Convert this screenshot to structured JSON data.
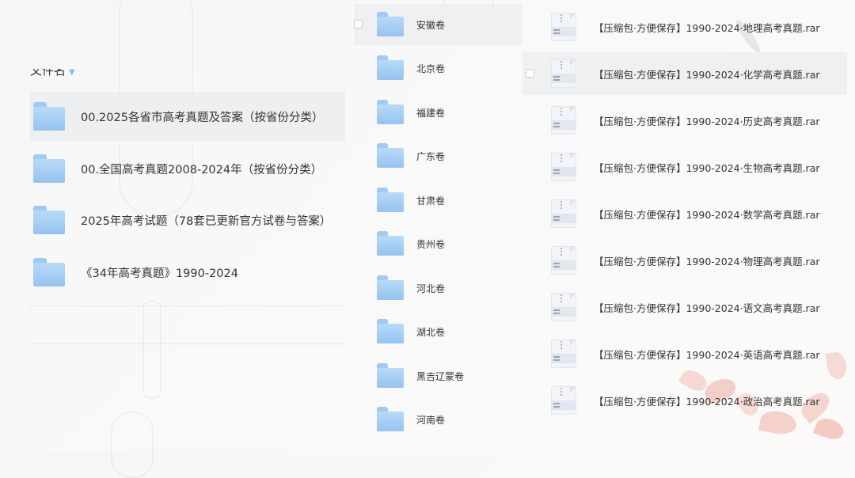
{
  "left": {
    "section_header": "文件名",
    "folders": [
      {
        "label": "00.2025各省市高考真题及答案（按省份分类）",
        "selected": true
      },
      {
        "label": "00.全国高考真题2008-2024年（按省份分类）",
        "selected": false
      },
      {
        "label": "2025年高考试题（78套已更新官方试卷与答案）",
        "selected": false
      },
      {
        "label": "《34年高考真题》1990-2024",
        "selected": false
      }
    ]
  },
  "middle": {
    "folders": [
      {
        "label": "安徽卷",
        "selected": true
      },
      {
        "label": "北京卷",
        "selected": false
      },
      {
        "label": "福建卷",
        "selected": false
      },
      {
        "label": "广东卷",
        "selected": false
      },
      {
        "label": "甘肃卷",
        "selected": false
      },
      {
        "label": "贵州卷",
        "selected": false
      },
      {
        "label": "河北卷",
        "selected": false
      },
      {
        "label": "湖北卷",
        "selected": false
      },
      {
        "label": "黑吉辽蒙卷",
        "selected": false
      },
      {
        "label": "河南卷",
        "selected": false
      }
    ]
  },
  "right": {
    "files": [
      {
        "label": "【压缩包·方便保存】1990-2024·地理高考真题.rar",
        "selected": false
      },
      {
        "label": "【压缩包·方便保存】1990-2024·化学高考真题.rar",
        "selected": true
      },
      {
        "label": "【压缩包·方便保存】1990-2024·历史高考真题.rar",
        "selected": false
      },
      {
        "label": "【压缩包·方便保存】1990-2024·生物高考真题.rar",
        "selected": false
      },
      {
        "label": "【压缩包·方便保存】1990-2024·数学高考真题.rar",
        "selected": false
      },
      {
        "label": "【压缩包·方便保存】1990-2024·物理高考真题.rar",
        "selected": false
      },
      {
        "label": "【压缩包·方便保存】1990-2024·语文高考真题.rar",
        "selected": false
      },
      {
        "label": "【压缩包·方便保存】1990-2024·英语高考真题.rar",
        "selected": false
      },
      {
        "label": "【压缩包·方便保存】1990-2024·政治高考真题.rar",
        "selected": false
      }
    ]
  },
  "colors": {
    "folder_blue": "#9fcaf3",
    "selected_row": "#eeeff1",
    "text": "#333333"
  },
  "icons": {
    "folder": "folder-icon",
    "archive": "archive-file-icon",
    "caret": "chevron-down-icon"
  }
}
